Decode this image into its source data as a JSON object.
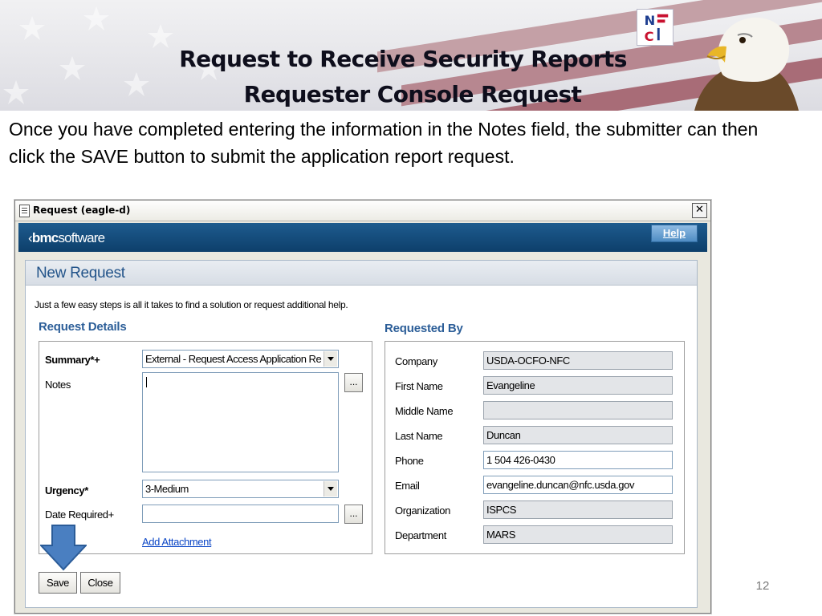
{
  "slide": {
    "title_line1": "Request to Receive Security Reports",
    "title_line2": "Requester Console Request",
    "intro": "Once you have completed entering the information in the Notes field, the submitter can then click the SAVE button to submit the application report request.",
    "page_number": "12",
    "logo_icon": "nfc-logo-icon",
    "decor_icon": "eagle-flag-banner-icon"
  },
  "window": {
    "title": "Request (eagle-d)",
    "close_symbol": "✕",
    "brand": {
      "prefix": "bmc",
      "suffix": "software"
    },
    "help_label": "Help"
  },
  "form": {
    "heading": "New Request",
    "hint": "Just a few easy steps is all it takes to find a solution or request additional help.",
    "details": {
      "title": "Request Details",
      "summary_label": "Summary*+",
      "summary_value": "External - Request Access Application Reports",
      "notes_label": "Notes",
      "notes_value": "",
      "urgency_label": "Urgency*",
      "urgency_value": "3-Medium",
      "date_label": "Date Required+",
      "date_value": "",
      "ellipsis": "...",
      "add_attachment": "Add Attachment"
    },
    "requested_by": {
      "title": "Requested By",
      "fields": [
        {
          "label": "Company",
          "value": "USDA-OCFO-NFC"
        },
        {
          "label": "First Name",
          "value": "Evangeline"
        },
        {
          "label": "Middle Name",
          "value": ""
        },
        {
          "label": "Last Name",
          "value": "Duncan"
        },
        {
          "label": "Phone",
          "value": "1 504 426-0430"
        },
        {
          "label": "Email",
          "value": "evangeline.duncan@nfc.usda.gov"
        },
        {
          "label": "Organization",
          "value": "ISPCS"
        },
        {
          "label": "Department",
          "value": "MARS"
        }
      ]
    },
    "buttons": {
      "save": "Save",
      "close": "Close"
    }
  },
  "colors": {
    "brand_bar": "#0d3f6b",
    "heading_blue": "#23548a",
    "pointer_arrow": "#4a7fc1",
    "link": "#0b46c6"
  }
}
